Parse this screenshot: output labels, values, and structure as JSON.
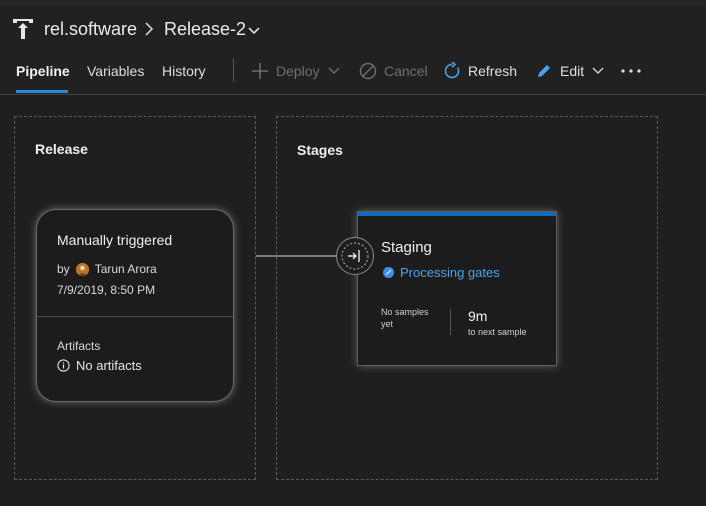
{
  "breadcrumb": {
    "project": "rel.software",
    "release": "Release-2"
  },
  "tabs": [
    {
      "label": "Pipeline",
      "active": true
    },
    {
      "label": "Variables",
      "active": false
    },
    {
      "label": "History",
      "active": false
    }
  ],
  "commands": {
    "deploy": "Deploy",
    "cancel": "Cancel",
    "refresh": "Refresh",
    "edit": "Edit"
  },
  "release_panel": {
    "title": "Release",
    "card": {
      "trigger": "Manually triggered",
      "by_prefix": "by",
      "author": "Tarun Arora",
      "date": "7/9/2019, 8:50 PM",
      "artifacts_label": "Artifacts",
      "artifacts_value": "No artifacts"
    }
  },
  "stages_panel": {
    "title": "Stages",
    "stage": {
      "name": "Staging",
      "status": "Processing gates",
      "no_samples": "No samples yet",
      "next_time": "9m",
      "next_label": "to next sample"
    }
  },
  "colors": {
    "accent": "#2b88d8",
    "stage_bar": "#0f6cbd",
    "status_link": "#4aa3f0",
    "background": "#1f1f1f"
  }
}
